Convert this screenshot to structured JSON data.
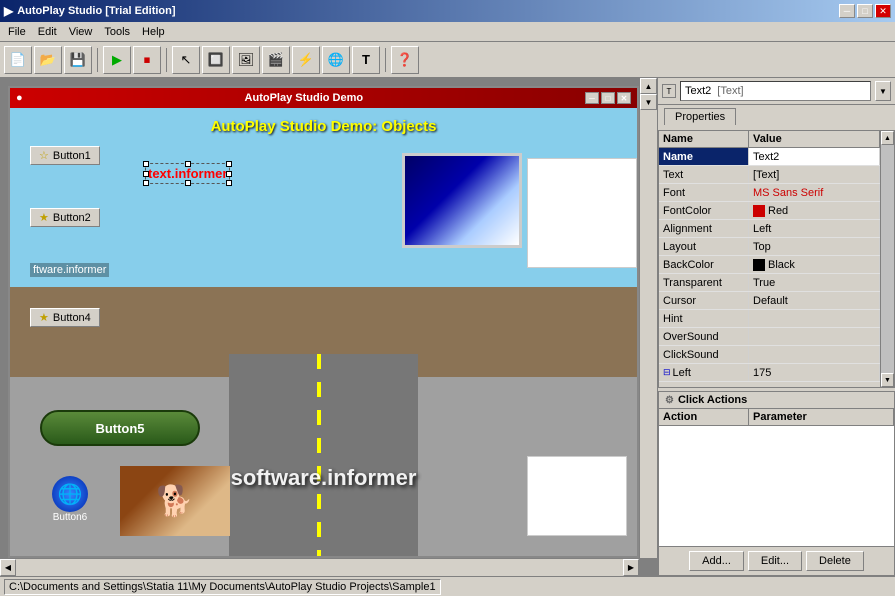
{
  "titleBar": {
    "title": "AutoPlay Studio [Trial Edition]",
    "minBtn": "─",
    "maxBtn": "□",
    "closeBtn": "✕"
  },
  "menuBar": {
    "items": [
      "File",
      "Edit",
      "View",
      "Tools",
      "Help"
    ]
  },
  "toolbar": {
    "buttons": [
      "new",
      "open",
      "save",
      "sep1",
      "run",
      "stop",
      "sep2",
      "arrow",
      "button",
      "image",
      "video",
      "flash",
      "web",
      "text",
      "sep3",
      "help"
    ]
  },
  "innerWindow": {
    "title": "AutoPlay Studio Demo",
    "demoTitle": "AutoPlay Studio Demo: Objects",
    "swText": "software.informer"
  },
  "demoElements": {
    "button1": "Button1",
    "button2": "Button2",
    "button4": "Button4",
    "button5": "Button5",
    "button6": "Button6",
    "textObj": "text.informer"
  },
  "rightPanel": {
    "objectSelector": {
      "name": "Text2",
      "type": "[Text]"
    },
    "tabs": [
      {
        "label": "Properties",
        "active": true
      }
    ],
    "propsHeader": {
      "nameCol": "Name",
      "valueCol": "Value"
    },
    "properties": [
      {
        "name": "Name",
        "value": "Text2",
        "highlighted": true,
        "editing": true
      },
      {
        "name": "Text",
        "value": "[Text]"
      },
      {
        "name": "Font",
        "value": "MS Sans Serif",
        "colored": true,
        "color": "#cc0000"
      },
      {
        "name": "FontColor",
        "value": "Red",
        "hasColorDot": true,
        "dotColor": "#cc0000"
      },
      {
        "name": "Alignment",
        "value": "Left"
      },
      {
        "name": "Layout",
        "value": "Top"
      },
      {
        "name": "BackColor",
        "value": "Black",
        "hasColorDot": true,
        "dotColor": "#000000"
      },
      {
        "name": "Transparent",
        "value": "True"
      },
      {
        "name": "Cursor",
        "value": "Default"
      },
      {
        "name": "Hint",
        "value": ""
      },
      {
        "name": "OverSound",
        "value": ""
      },
      {
        "name": "ClickSound",
        "value": ""
      },
      {
        "name": "Left",
        "value": "175",
        "hasLeftIcon": true
      }
    ],
    "clickActions": {
      "title": "Click Actions",
      "actionCol": "Action",
      "paramCol": "Parameter",
      "addBtn": "Add...",
      "editBtn": "Edit...",
      "deleteBtn": "Delete"
    }
  },
  "statusBar": {
    "path": "C:\\Documents and Settings\\Statia 11\\My Documents\\AutoPlay Studio Projects\\Sample1"
  }
}
